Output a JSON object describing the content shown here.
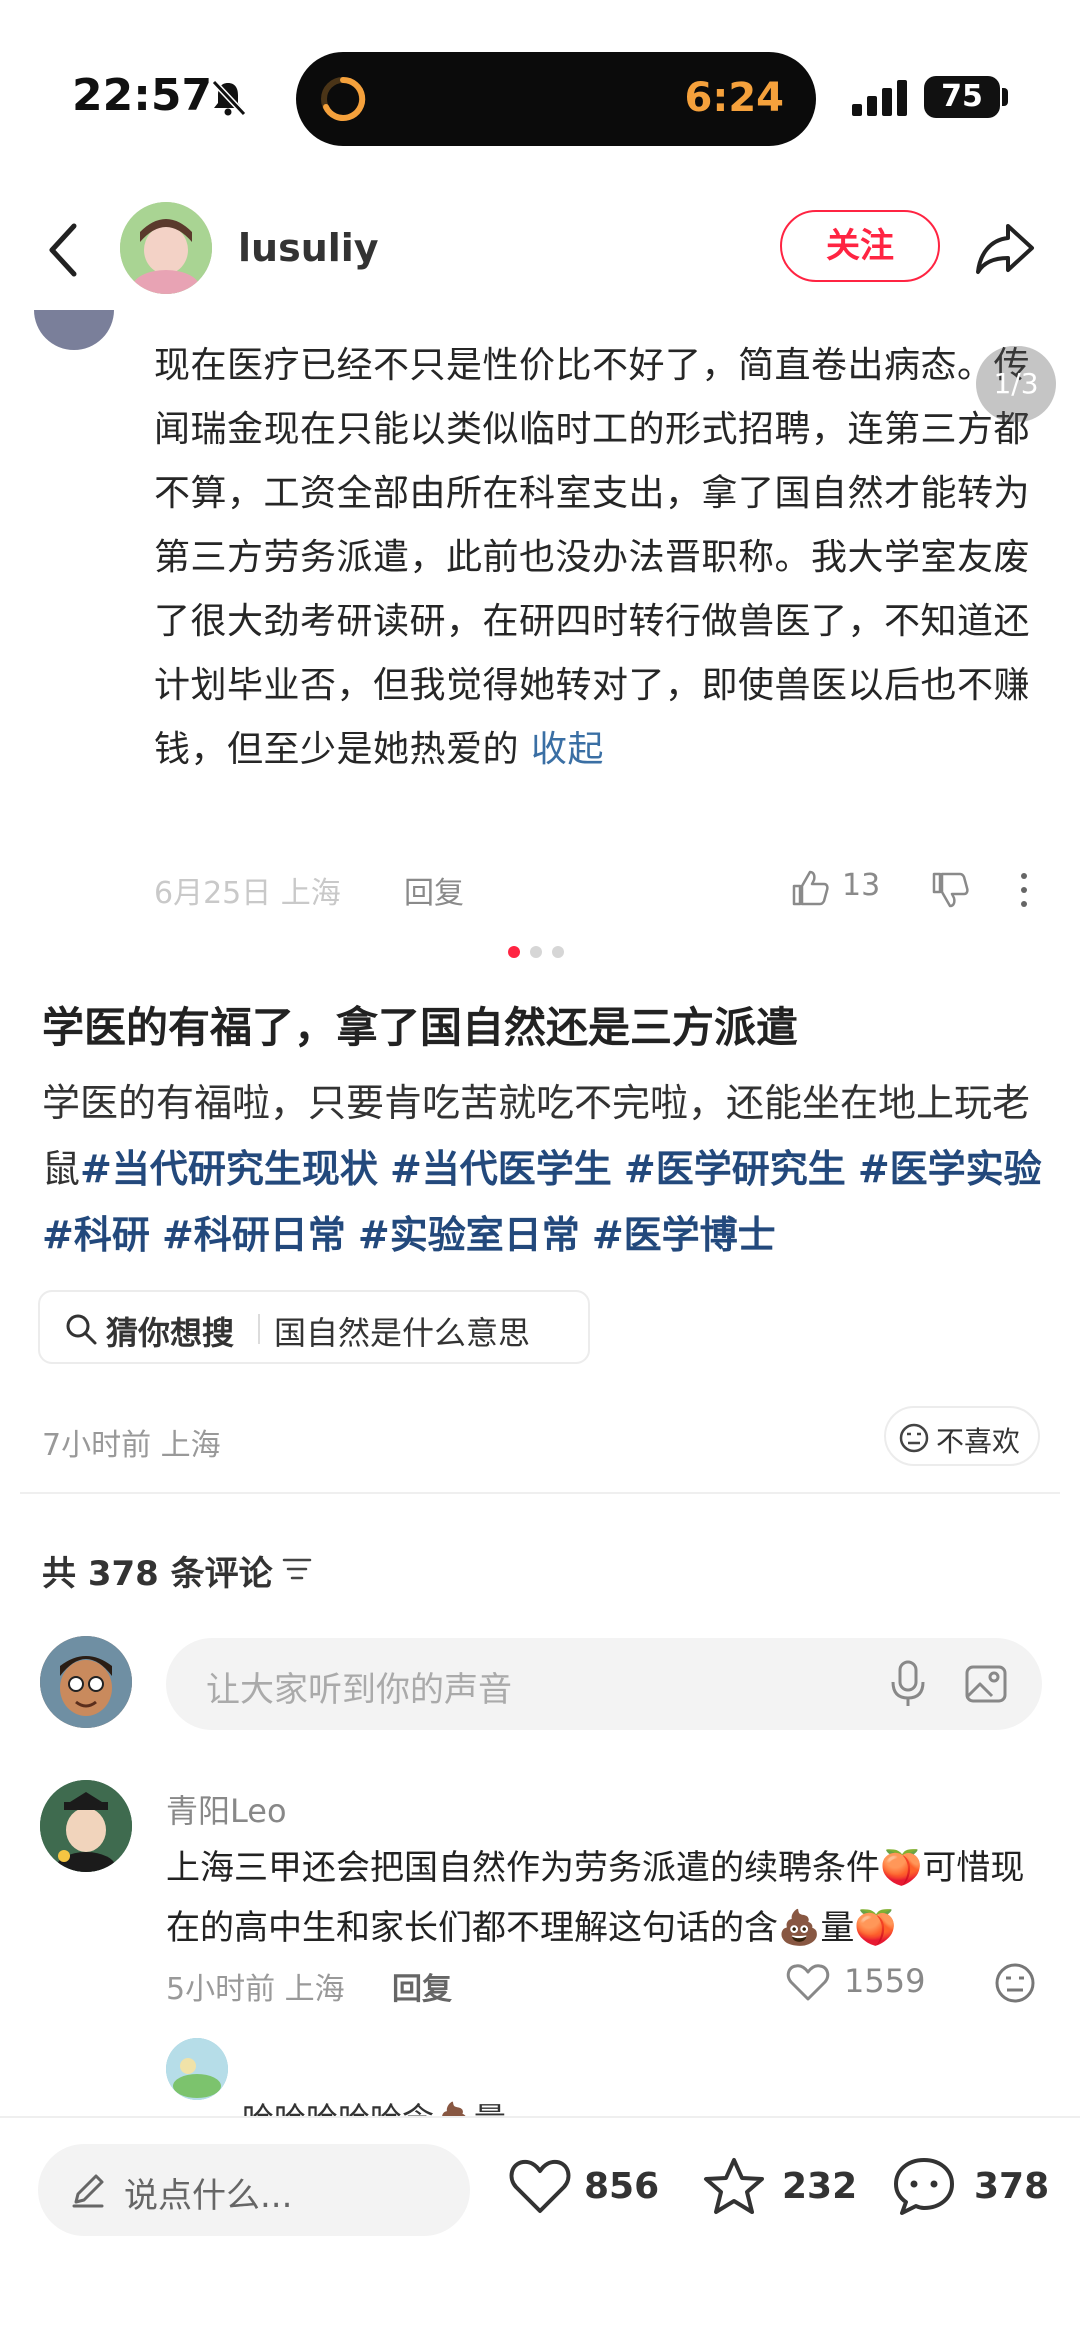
{
  "status_bar": {
    "time": "22:57",
    "island_time": "6:24",
    "battery": "75",
    "island_accent_color": "#f5a13c"
  },
  "header": {
    "author_name": "lusuliy",
    "follow_label": "关注",
    "accent_color": "#ff2442"
  },
  "media": {
    "counter": "1/3",
    "comment_text": "现在医疗已经不只是性价比不好了，简直卷出病态。传闻瑞金现在只能以类似临时工的形式招聘，连第三方都不算，工资全部由所在科室支出，拿了国自然才能转为第三方劳务派遣，此前也没办法晋职称。我大学室友废了很大劲考研读研，在研四时转行做兽医了，不知道还计划毕业否，但我觉得她转对了，即使兽医以后也不赚钱，但至少是她热爱的",
    "collapse_label": "收起",
    "date_location": "6月25日 上海",
    "reply_label": "回复",
    "like_count": "13",
    "image_count": 3,
    "current_image": 1
  },
  "note": {
    "title": "学医的有福了，拿了国自然还是三方派遣",
    "body": "学医的有福啦，只要肯吃苦就吃不完啦，还能坐在地上玩老鼠",
    "tags": [
      "#当代研究生现状",
      "#当代医学生",
      "#医学研究生",
      "#医学实验",
      "#科研",
      "#科研日常",
      "#实验室日常",
      "#医学博士"
    ],
    "tag_color": "#23497c",
    "suggest_label": "猜你想搜",
    "suggest_query": "国自然是什么意思",
    "time_location": "7小时前 上海",
    "dislike_label": "不喜欢"
  },
  "comments": {
    "count_label": "共 378 条评论",
    "input_placeholder": "让大家听到你的声音",
    "items": [
      {
        "name": "青阳Leo",
        "text_part1": "上海三甲还会把国自然作为劳务派遣的续聘条件",
        "text_part2": "可惜现在的高中生和家长们都不理解这句话的含",
        "text_part3": "量",
        "meta": "5小时前 上海",
        "reply_label": "回复",
        "like_count": "1559"
      }
    ],
    "reply_preview": "哈哈哈哈哈含💩量"
  },
  "bottom_bar": {
    "say_placeholder": "说点什么...",
    "like_count": "856",
    "collect_count": "232",
    "comment_count": "378"
  }
}
